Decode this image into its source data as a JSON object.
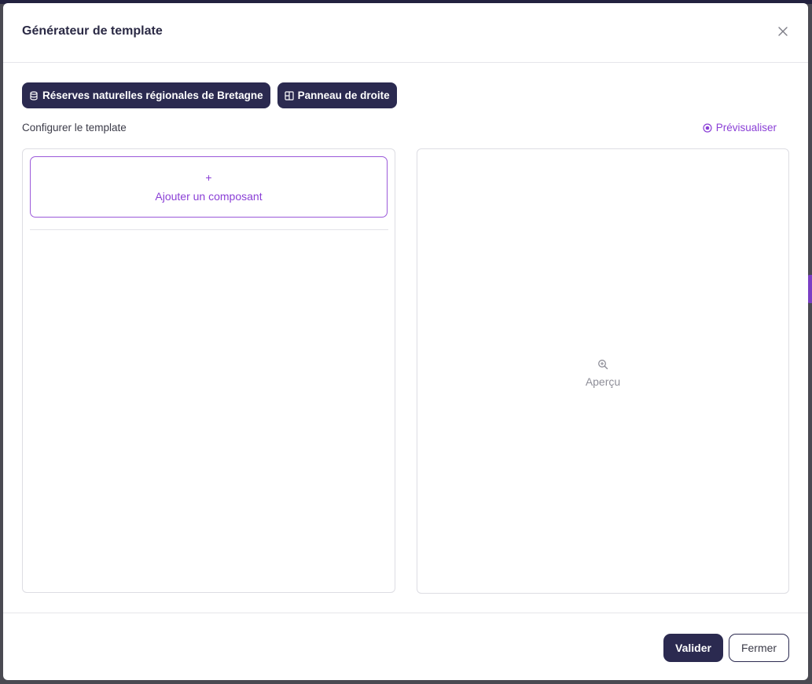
{
  "modal": {
    "title": "Générateur de template",
    "close_icon": "close-icon"
  },
  "chips": [
    {
      "label": "Réserves naturelles régionales de Bretagne",
      "icon": "database-icon"
    },
    {
      "label": "Panneau de droite",
      "icon": "layout-panel-icon"
    }
  ],
  "config": {
    "label": "Configurer le template",
    "preview_link": "Prévisualiser",
    "preview_icon": "eye-circle-icon"
  },
  "left_panel": {
    "add_symbol": "+",
    "add_label": "Ajouter un composant"
  },
  "right_panel": {
    "icon": "zoom-in-icon",
    "label": "Aperçu"
  },
  "footer": {
    "valider_label": "Valider",
    "fermer_label": "Fermer"
  },
  "colors": {
    "primary_dark": "#2b2a50",
    "accent_purple": "#8a3fd6",
    "border": "#dddde3"
  }
}
